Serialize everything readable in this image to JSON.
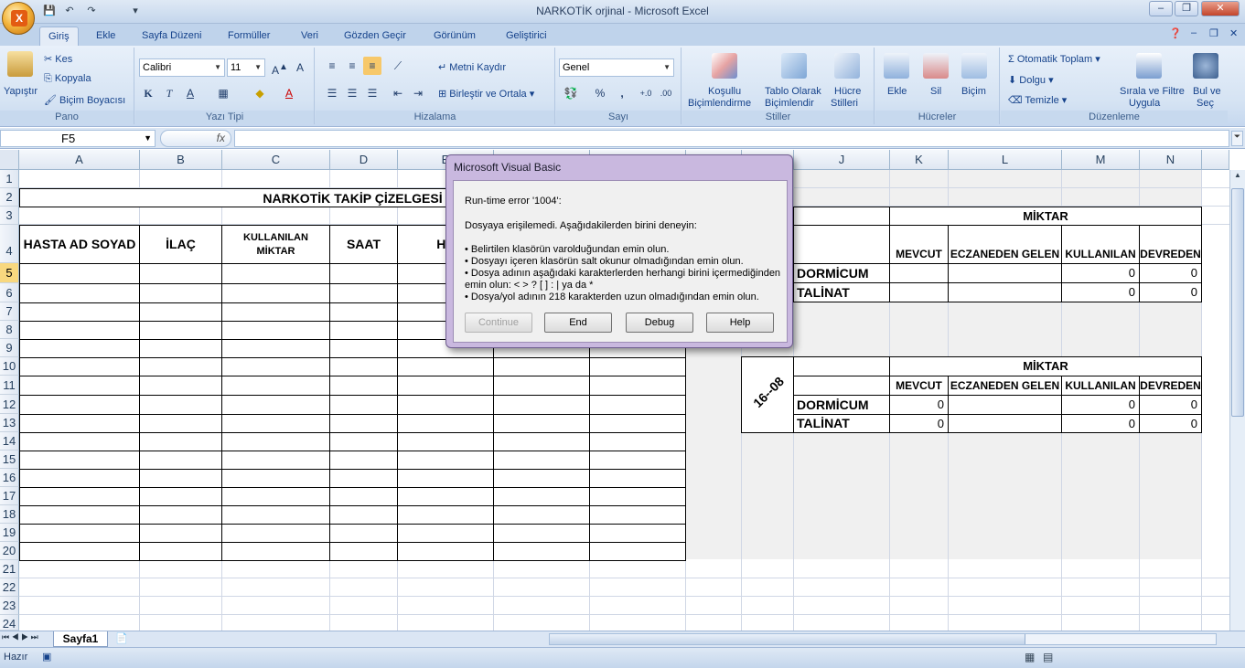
{
  "window": {
    "title": "NARKOTİK orjinal - Microsoft Excel",
    "min": "–",
    "restore": "❐",
    "close": "✕"
  },
  "office_button": {
    "glyph": "X"
  },
  "ribbon_tabs": [
    "Giriş",
    "Ekle",
    "Sayfa Düzeni",
    "Formüller",
    "Veri",
    "Gözden Geçir",
    "Görünüm",
    "Geliştirici"
  ],
  "ribbon": {
    "pano": {
      "label": "Pano",
      "paste": "Yapıştır",
      "cut": "Kes",
      "copy": "Kopyala",
      "format_painter": "Biçim Boyacısı"
    },
    "font": {
      "label": "Yazı Tipi",
      "name": "Calibri",
      "size": "11",
      "bold": "K",
      "italic": "T",
      "underline": "A",
      "color_a": "A"
    },
    "align": {
      "label": "Hizalama",
      "wrap": "Metni Kaydır",
      "merge": "Birleştir ve Ortala"
    },
    "number": {
      "label": "Sayı",
      "format": "Genel",
      "percent": "%",
      "comma": ","
    },
    "styles": {
      "label": "Stiller",
      "cond_1": "Koşullu",
      "cond_2": "Biçimlendirme",
      "table_1": "Tablo Olarak",
      "table_2": "Biçimlendir",
      "cell_1": "Hücre",
      "cell_2": "Stilleri"
    },
    "cells": {
      "label": "Hücreler",
      "insert": "Ekle",
      "delete": "Sil",
      "format": "Biçim"
    },
    "editing": {
      "label": "Düzenleme",
      "autosum": "Otomatik Toplam",
      "fill": "Dolgu",
      "clear": "Temizle",
      "sort_1": "Sırala ve Filtre",
      "sort_2": "Uygula",
      "find_1": "Bul ve",
      "find_2": "Seç"
    }
  },
  "formula_bar": {
    "name_box": "F5",
    "fx": "fx",
    "value": ""
  },
  "columns": [
    "A",
    "B",
    "C",
    "D",
    "E",
    "",
    "",
    "",
    "",
    "J",
    "K",
    "L",
    "M",
    "N"
  ],
  "rows": [
    "1",
    "2",
    "3",
    "4",
    "5",
    "6",
    "7",
    "8",
    "9",
    "10",
    "11",
    "12",
    "13",
    "14",
    "15",
    "16",
    "17",
    "18",
    "19",
    "20",
    "21",
    "22",
    "23",
    "24"
  ],
  "sheet": {
    "title": "NARKOTİK TAKİP ÇİZELGESİ",
    "headers": {
      "patient": "HASTA AD SOYAD",
      "drug": "İLAÇ",
      "used_1": "KULLANILAN",
      "used_2": "MİKTAR",
      "time": "SAAT",
      "e": "HE"
    },
    "table1": {
      "miktar": "MİKTAR",
      "cols": [
        "MEVCUT",
        "ECZANEDEN GELEN",
        "KULLANILAN",
        "DEVREDEN"
      ],
      "rows": [
        {
          "name": "DORMİCUM",
          "mevcut": "",
          "gelen": "",
          "kullanilan": "0",
          "devreden": "0"
        },
        {
          "name": "TALİNAT",
          "mevcut": "",
          "gelen": "",
          "kullanilan": "0",
          "devreden": "0"
        }
      ]
    },
    "table2": {
      "date": "16--08",
      "miktar": "MİKTAR",
      "cols": [
        "MEVCUT",
        "ECZANEDEN GELEN",
        "KULLANILAN",
        "DEVREDEN"
      ],
      "rows": [
        {
          "name": "DORMİCUM",
          "mevcut": "0",
          "gelen": "",
          "kullanilan": "0",
          "devreden": "0"
        },
        {
          "name": "TALİNAT",
          "mevcut": "0",
          "gelen": "",
          "kullanilan": "0",
          "devreden": "0"
        }
      ]
    }
  },
  "sheet_tabs": [
    "Sayfa1"
  ],
  "status": {
    "ready": "Hazır"
  },
  "dialog": {
    "title": "Microsoft Visual Basic",
    "error": "Run-time error '1004':",
    "message": "Dosyaya erişilemedi. Aşağıdakilerden birini deneyin:",
    "bullets": [
      "• Belirtilen klasörün varolduğundan emin olun.",
      "• Dosyayı içeren klasörün salt okunur olmadığından emin olun.",
      "• Dosya adının aşağıdaki karakterlerden herhangi birini içermediğinden",
      "emin olun:  <  >  ?  [  ]  :  |  ya da  *",
      "• Dosya/yol adının 218 karakterden uzun olmadığından emin olun."
    ],
    "buttons": {
      "continue": "Continue",
      "end": "End",
      "debug": "Debug",
      "help": "Help"
    }
  }
}
